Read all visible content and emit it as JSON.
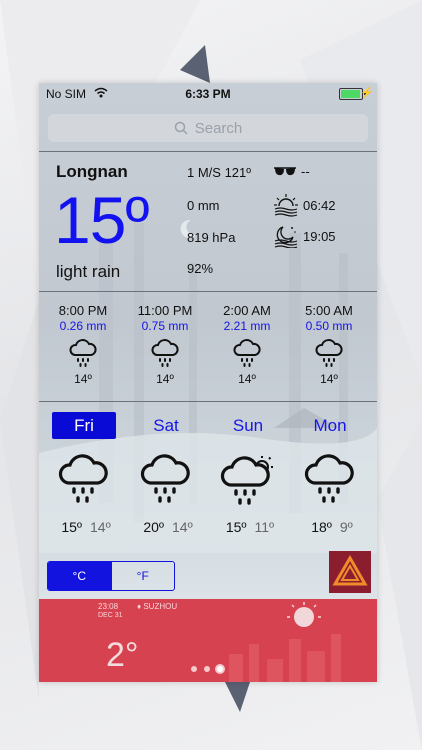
{
  "status_bar": {
    "carrier": "No SIM",
    "time": "6:33 PM",
    "battery_level": 0.95
  },
  "search": {
    "placeholder": "Search"
  },
  "current": {
    "city": "Longnan",
    "temperature": "15º",
    "condition": "light rain",
    "wind": "1 M/S 121º",
    "precipitation": "0 mm",
    "pressure": "819 hPa",
    "humidity": "92%",
    "visibility": "--",
    "sunrise": "06:42",
    "sunset": "19:05"
  },
  "hourly": [
    {
      "time": "8:00 PM",
      "precip": "0.26 mm",
      "icon": "rain-cloud-icon",
      "temp": "14º"
    },
    {
      "time": "11:00 PM",
      "precip": "0.75 mm",
      "icon": "rain-cloud-icon",
      "temp": "14º"
    },
    {
      "time": "2:00 AM",
      "precip": "2.21 mm",
      "icon": "rain-cloud-icon",
      "temp": "14º"
    },
    {
      "time": "5:00 AM",
      "precip": "0.50 mm",
      "icon": "rain-cloud-icon",
      "temp": "14º"
    }
  ],
  "daily": [
    {
      "day": "Fri",
      "selected": true,
      "icon": "rain-cloud-icon",
      "high": "15º",
      "low": "14º"
    },
    {
      "day": "Sat",
      "selected": false,
      "icon": "rain-cloud-icon",
      "high": "20º",
      "low": "14º"
    },
    {
      "day": "Sun",
      "selected": false,
      "icon": "rain-cloud-sun-icon",
      "high": "15º",
      "low": "11º"
    },
    {
      "day": "Mon",
      "selected": false,
      "icon": "rain-cloud-icon",
      "high": "18º",
      "low": "9º"
    }
  ],
  "units": {
    "celsius": "°C",
    "fahrenheit": "°F",
    "selected": "celsius"
  },
  "banner": {
    "time": "23:08",
    "date": "DEC 31",
    "location": "SUZHOU",
    "temperature": "2°",
    "page_count": 3,
    "active_page": 3
  },
  "colors": {
    "accent": "#1313e0",
    "banner": "#d6424f",
    "promo_icon": "#8b1e2e"
  }
}
